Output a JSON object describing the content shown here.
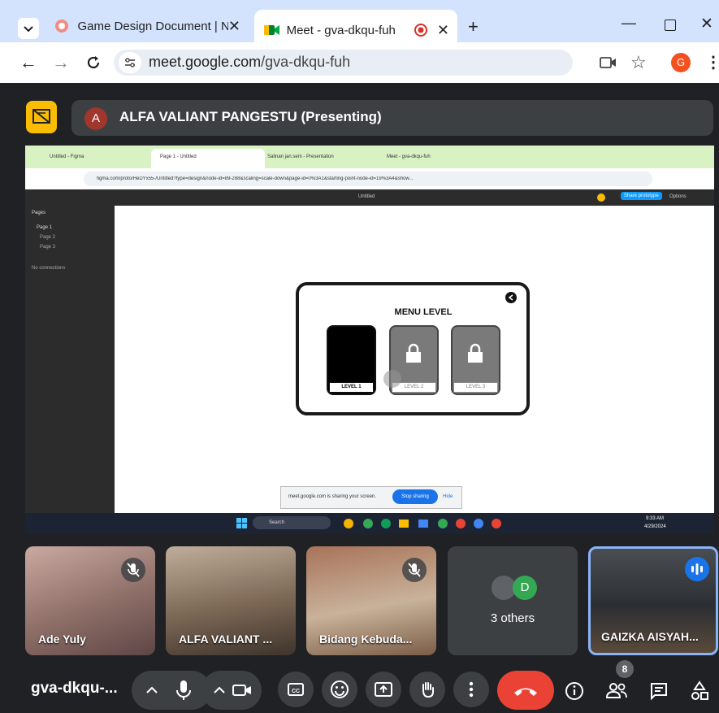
{
  "browser": {
    "tabs": [
      {
        "title": "Game Design Document | Nucli"
      },
      {
        "title": "Meet - gva-dkqu-fuh"
      }
    ],
    "url_domain": "meet.google.com",
    "url_path": "/gva-dkqu-fuh",
    "profile_initial": "G"
  },
  "presenter": {
    "initial": "A",
    "label": "ALFA VALIANT PANGESTU (Presenting)"
  },
  "shared_screen": {
    "tabs": [
      "Untitled - Figma",
      "Page 1 - Untitled",
      "Salinan jan.sem - Presentation",
      "Meet - gva-dkqu-fuh"
    ],
    "url": "figma.com/proto/HeDYx55-/Untitled?type=design&node-id=89-288&scaling=scale-down&page-id=0%3A1&starting-point-node-id=19%3A4&show...",
    "figma_file_title": "Untitled",
    "share_btn": "Share prototype",
    "options_btn": "Options",
    "sidebar_title": "Pages",
    "pages": [
      "Page 1",
      "Page 2",
      "Page 3"
    ],
    "flows_label": "No connections",
    "menu_title": "MENU LEVEL",
    "levels": [
      "LEVEL 1",
      "LEVEL 2",
      "LEVEL 3"
    ],
    "sharing_notice": "meet.google.com is sharing your screen.",
    "stop_sharing": "Stop sharing",
    "hide": "Hide",
    "search_label": "Search",
    "time": "9:33 AM",
    "date": "4/29/2024"
  },
  "participants": [
    {
      "name": "Ade Yuly",
      "muted": true
    },
    {
      "name": "ALFA VALIANT ...",
      "muted": false
    },
    {
      "name": "Bidang Kebuda...",
      "muted": true
    },
    {
      "name": "3 others",
      "initial": "D"
    },
    {
      "name": "GAIZKA AISYAH...",
      "speaking": true
    }
  ],
  "controls": {
    "meeting_code": "gva-dkqu-...",
    "people_count": "8"
  },
  "colors": {
    "accent_blue": "#8ab4f8",
    "end_call_red": "#ea4335",
    "avatar_green": "#34a853"
  }
}
